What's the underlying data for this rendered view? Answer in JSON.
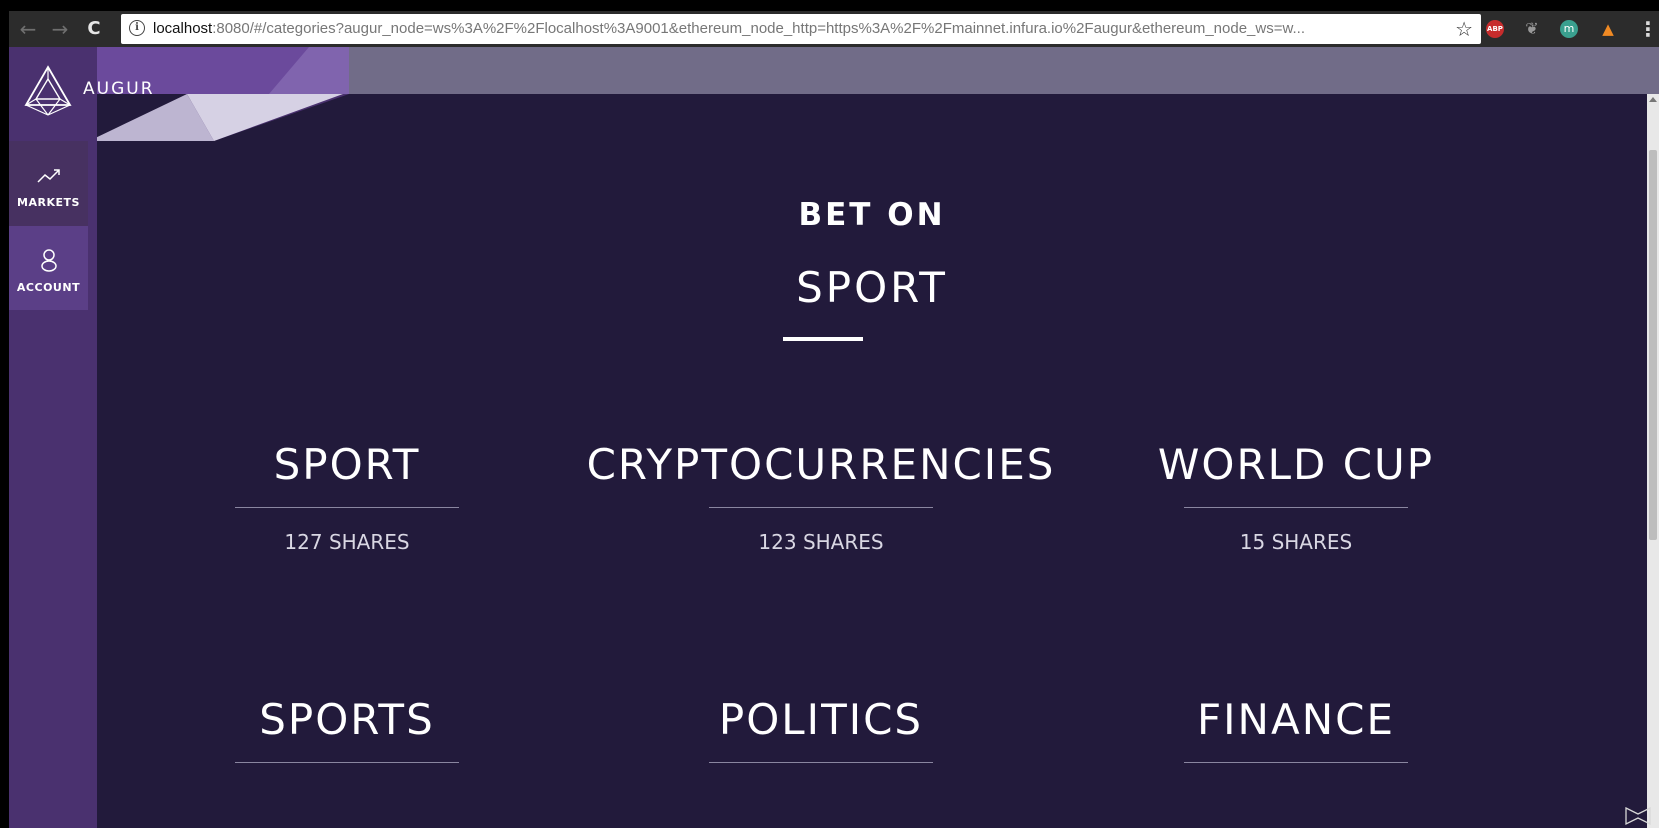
{
  "browser": {
    "url_host": "localhost",
    "url_rest": ":8080/#/categories?augur_node=ws%3A%2F%2Flocalhost%3A9001&ethereum_node_http=https%3A%2F%2Fmainnet.infura.io%2Faugur&ethereum_node_ws=w...",
    "back_glyph": "←",
    "forward_glyph": "→",
    "reload_glyph": "C",
    "star_glyph": "☆",
    "menu_glyph": "⋮",
    "extensions": [
      {
        "name": "adblock-plus-icon",
        "label": "ABP",
        "color": "#c72c2c"
      },
      {
        "name": "evernote-icon",
        "label": "",
        "color": "#999999"
      },
      {
        "name": "m-extension-icon",
        "label": "m",
        "color": "#3aa08f"
      },
      {
        "name": "metamask-icon",
        "label": "",
        "color": "#f08a24"
      }
    ]
  },
  "app": {
    "brand": "AUGUR",
    "colors": {
      "sidebar": "#4a316f",
      "background": "#221a3b",
      "topbar": "#716c88"
    }
  },
  "sidebar": {
    "items": [
      {
        "label": "MARKETS",
        "icon": "trend-up-icon"
      },
      {
        "label": "ACCOUNT",
        "icon": "user-icon"
      }
    ]
  },
  "hero": {
    "kicker": "BET ON",
    "title": "SPORT"
  },
  "categories": [
    {
      "name": "SPORT",
      "shares": "127 SHARES"
    },
    {
      "name": "CRYPTOCURRENCIES",
      "shares": "123 SHARES"
    },
    {
      "name": "WORLD CUP",
      "shares": "15 SHARES"
    },
    {
      "name": "SPORTS",
      "shares": ""
    },
    {
      "name": "POLITICS",
      "shares": ""
    },
    {
      "name": "FINANCE",
      "shares": ""
    }
  ]
}
